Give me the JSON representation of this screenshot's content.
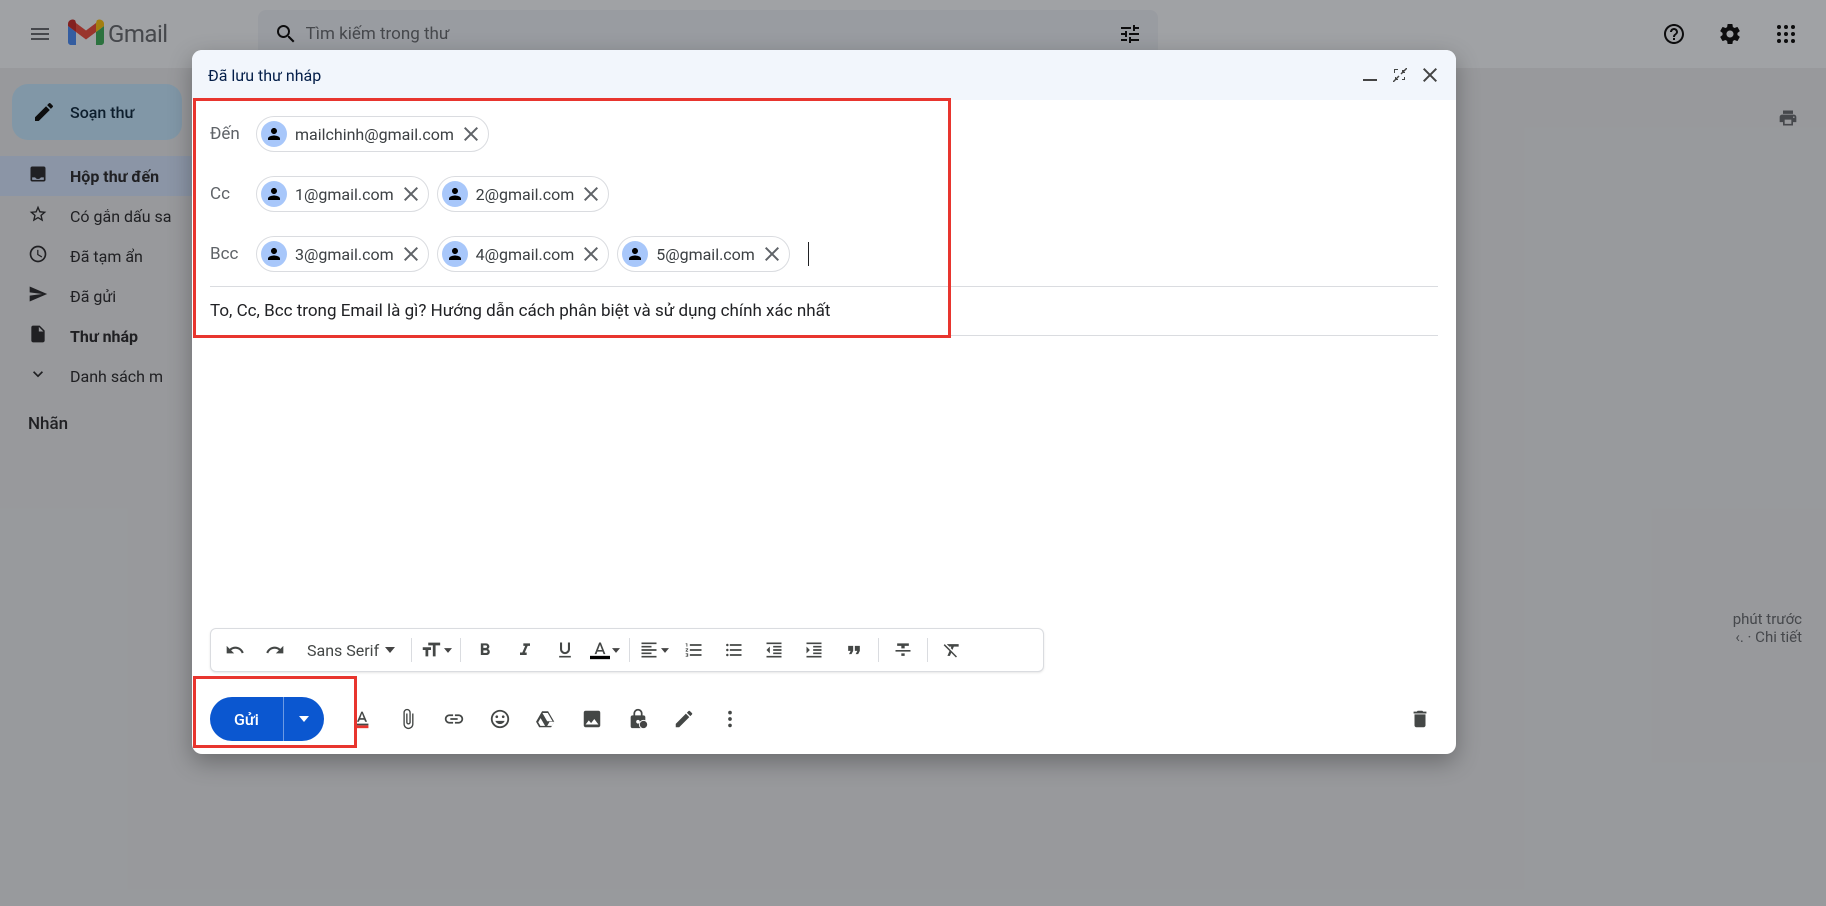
{
  "header": {
    "product": "Gmail",
    "search_placeholder": "Tìm kiếm trong thư"
  },
  "sidebar": {
    "compose": "Soạn thư",
    "items": [
      {
        "label": "Hộp thư đến",
        "icon": "inbox",
        "active": true
      },
      {
        "label": "Có gắn dấu sa",
        "icon": "star"
      },
      {
        "label": "Đã tạm ẩn",
        "icon": "clock"
      },
      {
        "label": "Đã gửi",
        "icon": "send"
      },
      {
        "label": "Thư nháp",
        "icon": "draft",
        "bold": true
      },
      {
        "label": "Danh sách m",
        "icon": "expand"
      }
    ],
    "section": "Nhãn"
  },
  "compose": {
    "title": "Đã lưu thư nháp",
    "to_label": "Đến",
    "cc_label": "Cc",
    "bcc_label": "Bcc",
    "to": [
      "mailchinh@gmail.com"
    ],
    "cc": [
      "1@gmail.com",
      "2@gmail.com"
    ],
    "bcc": [
      "3@gmail.com",
      "4@gmail.com",
      "5@gmail.com"
    ],
    "subject": "To, Cc, Bcc trong Email là gì? Hướng dẫn cách phân biệt và sử dụng chính xác nhất",
    "font": "Sans Serif",
    "send": "Gửi"
  },
  "right": {
    "time": "phút trước",
    "detail": "‹. · Chi tiết"
  }
}
